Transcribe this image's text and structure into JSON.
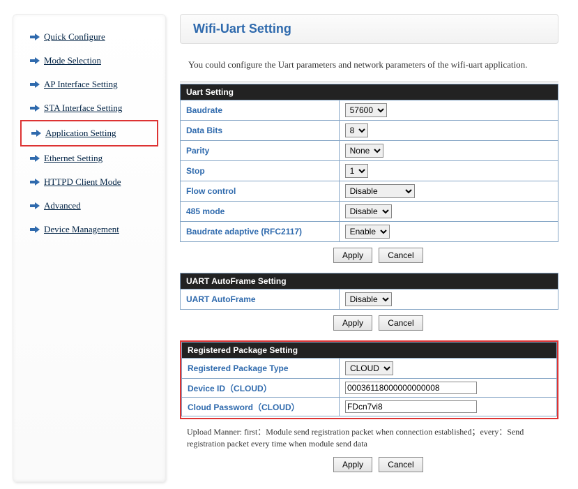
{
  "sidebar": {
    "items": [
      {
        "label": "Quick Configure"
      },
      {
        "label": "Mode Selection"
      },
      {
        "label": "AP Interface Setting"
      },
      {
        "label": "STA Interface Setting"
      },
      {
        "label": "Application Setting"
      },
      {
        "label": "Ethernet Setting"
      },
      {
        "label": "HTTPD Client Mode"
      },
      {
        "label": "Advanced"
      },
      {
        "label": "Device Management"
      }
    ]
  },
  "main": {
    "title": "Wifi-Uart Setting",
    "desc": "You could configure the Uart parameters and network parameters of the wifi-uart application."
  },
  "uart": {
    "header": "Uart Setting",
    "baudrate_label": "Baudrate",
    "baudrate_value": "57600",
    "databits_label": "Data Bits",
    "databits_value": "8",
    "parity_label": "Parity",
    "parity_value": "None",
    "stop_label": "Stop",
    "stop_value": "1",
    "flow_label": "Flow control",
    "flow_value": "Disable",
    "r485_label": "485 mode",
    "r485_value": "Disable",
    "adaptive_label": "Baudrate adaptive (RFC2117)",
    "adaptive_value": "Enable"
  },
  "autoframe": {
    "header": "UART AutoFrame Setting",
    "label": "UART AutoFrame",
    "value": "Disable"
  },
  "reg": {
    "header": "Registered Package Setting",
    "type_label": "Registered Package Type",
    "type_value": "CLOUD",
    "devid_label": "Device ID（CLOUD）",
    "devid_value": "00036118000000000008",
    "pwd_label": "Cloud Password（CLOUD）",
    "pwd_value": "FDcn7vi8"
  },
  "upload_note": "Upload Manner: first：Module send registration packet when connection established；every：Send registration packet every time when module send data",
  "buttons": {
    "apply": "Apply",
    "cancel": "Cancel"
  }
}
